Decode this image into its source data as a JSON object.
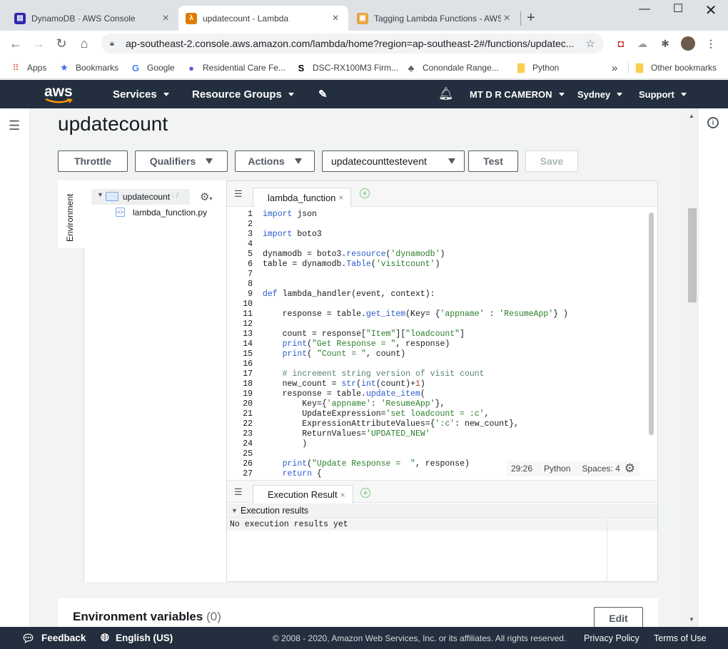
{
  "browser": {
    "tabs": [
      {
        "label": "DynamoDB · AWS Console",
        "icon": "dynamodb-icon",
        "color": "#2e27ad"
      },
      {
        "label": "updatecount - Lambda",
        "icon": "lambda-icon",
        "color": "#e07b00"
      },
      {
        "label": "Tagging Lambda Functions - AWS",
        "icon": "aws-docs-icon",
        "color": "#e8a33d"
      }
    ],
    "new_tab": "+",
    "url": "ap-southeast-2.console.aws.amazon.com/lambda/home?region=ap-southeast-2#/functions/updatec...",
    "bookmarks": [
      {
        "label": "Apps",
        "icon": "apps-grid-icon"
      },
      {
        "label": "Bookmarks",
        "icon": "star-icon"
      },
      {
        "label": "Google",
        "icon": "google-icon"
      },
      {
        "label": "Residential Care Fe...",
        "icon": "globe-icon"
      },
      {
        "label": "DSC-RX100M3 Firm...",
        "icon": "sony-icon"
      },
      {
        "label": "Conondale Range...",
        "icon": "bookmark-favicon-icon"
      },
      {
        "label": "Python",
        "icon": "folder-icon"
      }
    ],
    "overflow": "»",
    "other_bookmarks": "Other bookmarks"
  },
  "aws_header": {
    "logo": "aws",
    "services": "Services",
    "resource_groups": "Resource Groups",
    "account": "MT D R CAMERON",
    "region": "Sydney",
    "support": "Support"
  },
  "page": {
    "title": "updatecount",
    "buttons": {
      "throttle": "Throttle",
      "qualifiers": "Qualifiers",
      "actions": "Actions",
      "test_event": "updatecounttestevent",
      "test": "Test",
      "save": "Save"
    }
  },
  "ide": {
    "side_tab": "Environment",
    "tree": {
      "folder": "updatecount",
      "folder_suffix": "- /",
      "file": "lambda_function.py"
    },
    "editor_tab": "lambda_function",
    "code_lines": [
      "import json",
      "",
      "import boto3",
      "",
      "dynamodb = boto3.resource('dynamodb')",
      "table = dynamodb.Table('visitcount')",
      "",
      "",
      "def lambda_handler(event, context):",
      "",
      "    response = table.get_item(Key= {'appname' : 'ResumeApp'} )",
      "",
      "    count = response[\"Item\"][\"loadcount\"]",
      "    print(\"Get Response = \", response)",
      "    print( \"Count = \", count)",
      "",
      "    # increment string version of visit count",
      "    new_count = str(int(count)+1)",
      "    response = table.update_item(",
      "        Key={'appname': 'ResumeApp'},",
      "        UpdateExpression='set loadcount = :c',",
      "        ExpressionAttributeValues={':c': new_count},",
      "        ReturnValues='UPDATED_NEW'",
      "        )",
      "",
      "    print(\"Update Response =  \", response)",
      "    return {"
    ],
    "status": {
      "position": "29:26",
      "language": "Python",
      "spaces": "Spaces: 4"
    },
    "results_tab": "Execution Result",
    "results_header": "Execution results",
    "results_text": "No execution results yet"
  },
  "env_section": {
    "title": "Environment variables",
    "count": "(0)",
    "edit": "Edit"
  },
  "footer": {
    "feedback": "Feedback",
    "language": "English (US)",
    "copyright": "© 2008 - 2020, Amazon Web Services, Inc. or its affiliates. All rights reserved.",
    "privacy": "Privacy Policy",
    "terms": "Terms of Use"
  },
  "colors": {
    "aws_nav": "#232f3e",
    "aws_orange": "#ff9900",
    "keyword": "#2b5ccf",
    "string": "#2a7e2a"
  }
}
